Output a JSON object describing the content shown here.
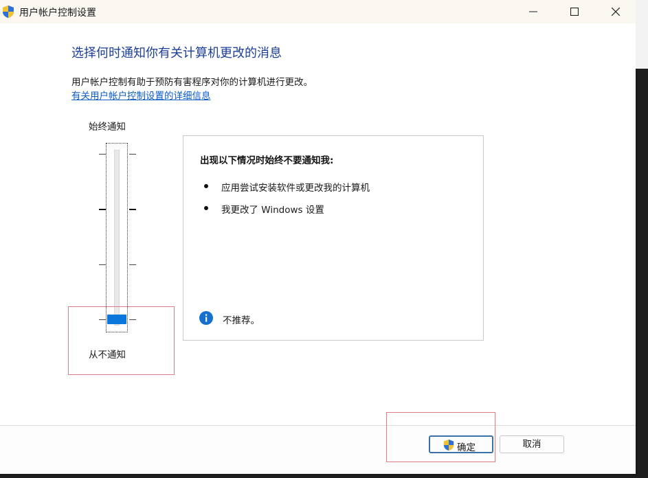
{
  "window": {
    "title": "用户帐户控制设置",
    "icon": "uac-shield-icon"
  },
  "titlebar_controls": {
    "minimize_icon": "minimize-icon",
    "maximize_icon": "maximize-icon",
    "close_icon": "close-icon"
  },
  "main": {
    "heading": "选择何时通知你有关计算机更改的消息",
    "description": "用户帐户控制有助于预防有害程序对你的计算机进行更改。",
    "link_text": "有关用户帐户控制设置的详细信息"
  },
  "slider": {
    "top_label": "始终通知",
    "bottom_label": "从不通知",
    "levels": 4,
    "selected_level": 1,
    "accent_color": "#0b77dd"
  },
  "info_panel": {
    "heading": "出现以下情况时始终不要通知我:",
    "bullets": [
      "应用尝试安装软件或更改我的计算机",
      "我更改了 Windows 设置"
    ],
    "note_icon": "info-icon",
    "note": "不推荐。"
  },
  "buttons": {
    "ok_label": "确定",
    "ok_icon": "uac-shield-icon",
    "cancel_label": "取消"
  },
  "annotation_color": "#e07b85"
}
